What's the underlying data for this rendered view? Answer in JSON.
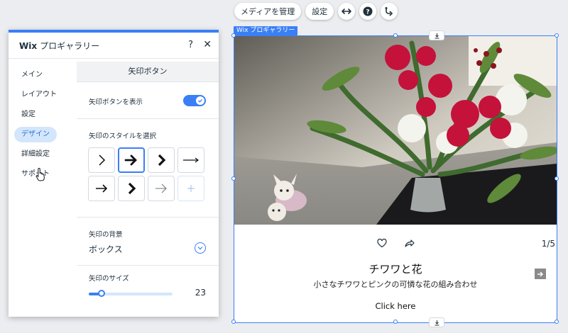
{
  "toolbar": {
    "manage_media_label": "メディアを管理",
    "settings_label": "設定",
    "icons": [
      "stretch-icon",
      "help-icon",
      "connect-icon"
    ]
  },
  "selection": {
    "label": "Wix プロギャラリー"
  },
  "gallery": {
    "counter": "1/5",
    "item_title": "チワワと花",
    "item_description": "小さなチワワとピンクの可憐な花の組み合わせ",
    "link_text": "Click here"
  },
  "panel": {
    "title_brand": "Wix",
    "title_rest": "プロギャラリー",
    "help": "?",
    "close": "✕",
    "nav": [
      {
        "label": "メイン"
      },
      {
        "label": "レイアウト"
      },
      {
        "label": "設定"
      },
      {
        "label": "デザイン",
        "active": true
      },
      {
        "label": "詳細設定"
      },
      {
        "label": "サポート"
      }
    ],
    "section_title": "矢印ボタン",
    "show_arrows": {
      "label": "矢印ボタンを表示",
      "on": true
    },
    "arrow_style": {
      "label": "矢印のスタイルを選択",
      "selected_index": 1,
      "options": [
        "chevron-thin",
        "arrow-bold",
        "chevron-bold",
        "arrow-thin-long",
        "arrow-medium",
        "chevron-bold-2",
        "arrow-light",
        "add"
      ]
    },
    "arrow_background": {
      "label": "矢印の背景",
      "value": "ボックス"
    },
    "arrow_size": {
      "label": "矢印のサイズ",
      "value": 23,
      "fraction": 0.15
    }
  },
  "colors": {
    "accent": "#3a7ff6",
    "nav_active_bg": "#d3e6fb"
  }
}
